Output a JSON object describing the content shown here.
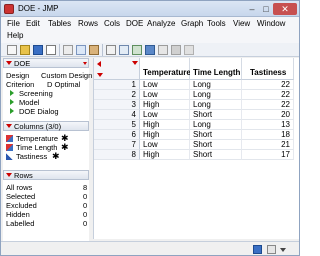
{
  "window": {
    "title": "DOE - JMP"
  },
  "menu": {
    "file": "File",
    "edit": "Edit",
    "tables": "Tables",
    "rows": "Rows",
    "cols": "Cols",
    "doe": "DOE",
    "analyze": "Analyze",
    "graph": "Graph",
    "tools": "Tools",
    "view": "View",
    "window": "Window",
    "help": "Help"
  },
  "table_panel": {
    "title": "DOE",
    "design_label": "Design",
    "design_value": "Custom Design",
    "criterion_label": "Criterion",
    "criterion_value": "D Optimal",
    "scripts": [
      "Screening",
      "Model",
      "DOE Dialog"
    ]
  },
  "columns_panel": {
    "title": "Columns (3/0)",
    "columns": [
      "Temperature",
      "Time Length",
      "Tastiness"
    ]
  },
  "rows_panel": {
    "title": "Rows",
    "items": [
      {
        "label": "All rows",
        "value": "8"
      },
      {
        "label": "Selected",
        "value": "0"
      },
      {
        "label": "Excluded",
        "value": "0"
      },
      {
        "label": "Hidden",
        "value": "0"
      },
      {
        "label": "Labelled",
        "value": "0"
      }
    ]
  },
  "table": {
    "headers": [
      "Temperature",
      "Time Length",
      "Tastiness"
    ],
    "rows": [
      {
        "n": "1",
        "temperature": "Low",
        "time": "Long",
        "tastiness": "22"
      },
      {
        "n": "2",
        "temperature": "Low",
        "time": "Long",
        "tastiness": "22"
      },
      {
        "n": "3",
        "temperature": "High",
        "time": "Long",
        "tastiness": "22"
      },
      {
        "n": "4",
        "temperature": "Low",
        "time": "Short",
        "tastiness": "20"
      },
      {
        "n": "5",
        "temperature": "High",
        "time": "Long",
        "tastiness": "13"
      },
      {
        "n": "6",
        "temperature": "High",
        "time": "Short",
        "tastiness": "18"
      },
      {
        "n": "7",
        "temperature": "Low",
        "time": "Short",
        "tastiness": "21"
      },
      {
        "n": "8",
        "temperature": "High",
        "time": "Short",
        "tastiness": "17"
      }
    ]
  },
  "colors": {
    "accent_red": "#cc0000",
    "title_bar": "#c7d7ec",
    "close_button": "#c75050"
  },
  "icons": [
    "app-icon",
    "minimize-icon",
    "maximize-icon",
    "close-icon",
    "script-icon",
    "column-icon",
    "star-icon"
  ]
}
